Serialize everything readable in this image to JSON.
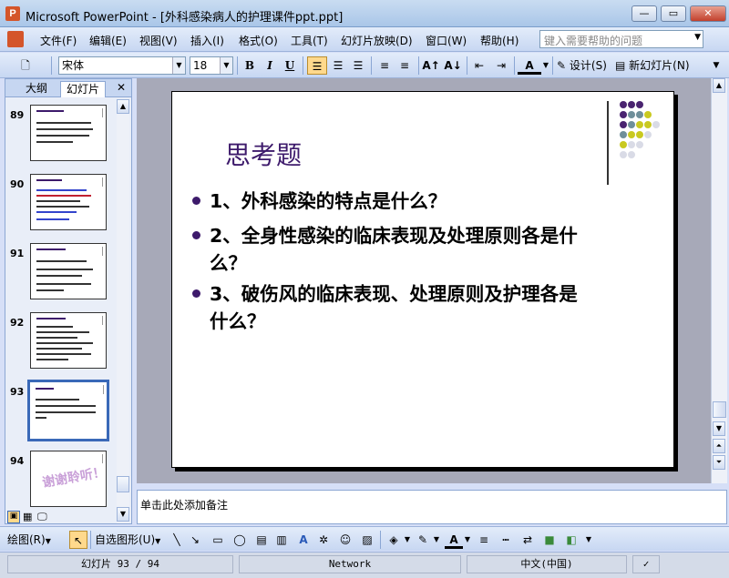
{
  "window": {
    "title": "Microsoft PowerPoint - [外科感染病人的护理课件ppt.ppt]",
    "app_icon": "P",
    "buttons": {
      "minimize": "—",
      "restore": "▭",
      "close": "✕"
    }
  },
  "menu": {
    "items": [
      "文件(F)",
      "编辑(E)",
      "视图(V)",
      "插入(I)",
      "格式(O)",
      "工具(T)",
      "幻灯片放映(D)",
      "窗口(W)",
      "帮助(H)"
    ],
    "help_placeholder": "键入需要帮助的问题"
  },
  "toolbar": {
    "font_name": "宋体",
    "font_size": "18",
    "bold": "B",
    "italic": "I",
    "underline": "U",
    "design_label": "设计(S)",
    "new_slide_label": "新幻灯片(N)"
  },
  "left_panel": {
    "tabs": [
      "大纲",
      "幻灯片"
    ],
    "close": "✕",
    "slide_numbers": [
      "89",
      "90",
      "91",
      "92",
      "93",
      "94"
    ],
    "selected_slide": "93",
    "thumb_94_text": "谢谢聆听！"
  },
  "slide": {
    "title": "思考题",
    "bullets": [
      {
        "lines": [
          "1、外科感染的特点是什么？"
        ]
      },
      {
        "lines": [
          "2、全身性感染的临床表现及处理原则各是什",
          "么？"
        ]
      },
      {
        "lines": [
          "3、破伤风的临床表现、处理原则及护理各是",
          "什么？"
        ]
      }
    ],
    "colors": {
      "title": "#3d1a6b",
      "bullet": "#3d1a6b",
      "dot_purple": "#4a2470",
      "dot_teal": "#6f8f9a",
      "dot_yellow": "#c9c920",
      "dot_light": "#d9dbe6"
    }
  },
  "notes": {
    "placeholder": "单击此处添加备注"
  },
  "drawbar": {
    "draw_label": "绘图(R)",
    "autoshapes_label": "自选图形(U)"
  },
  "status": {
    "slide_info": "幻灯片 93 / 94",
    "template": "Network",
    "language": "中文(中国)"
  }
}
